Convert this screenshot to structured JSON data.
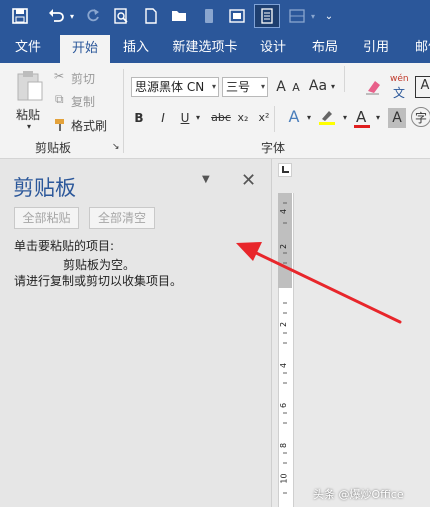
{
  "quick_access": {
    "icons": [
      "save-icon",
      "undo-icon",
      "redo-icon",
      "print-preview-icon",
      "new-document-icon",
      "open-folder-icon",
      "touch-mode-icon",
      "screenshot-icon",
      "read-mode-icon",
      "format-icon",
      "customize-icon"
    ]
  },
  "tabs": [
    {
      "label": "文件"
    },
    {
      "label": "开始",
      "active": true
    },
    {
      "label": "插入"
    },
    {
      "label": "新建选项卡"
    },
    {
      "label": "设计"
    },
    {
      "label": "布局"
    },
    {
      "label": "引用"
    },
    {
      "label": "邮件"
    }
  ],
  "clipboard_group": {
    "paste_label": "粘贴",
    "cut_label": "剪切",
    "copy_label": "复制",
    "format_painter_label": "格式刷",
    "group_label": "剪贴板"
  },
  "font_group": {
    "font_name": "思源黑体 CN",
    "font_size": "三号",
    "grow_label": "A",
    "shrink_label": "A",
    "case_label": "Aa",
    "phonetic_top": "wén",
    "phonetic_bottom": "文",
    "bold": "B",
    "italic": "I",
    "underline": "U",
    "strike": "abc",
    "subscript": "x₂",
    "superscript": "x²",
    "text_effect": "A",
    "font_color": "A",
    "char_shading": "A",
    "group_label": "字体",
    "colors": {
      "highlight": "#ffff00",
      "font_color": "#e01f1f"
    }
  },
  "clipboard_pane": {
    "title": "剪贴板",
    "paste_all": "全部粘贴",
    "clear_all": "全部清空",
    "instruction": "单击要粘贴的项目:",
    "empty_message": "剪贴板为空。",
    "hint": "请进行复制或剪切以收集项目。"
  },
  "ruler": {
    "labels": [
      "4",
      "2",
      "2",
      "4",
      "6",
      "8",
      "10"
    ]
  },
  "watermark": "头条 @爆炒Office",
  "colors": {
    "brand": "#2b579a",
    "annotation_arrow": "#e8262b"
  }
}
